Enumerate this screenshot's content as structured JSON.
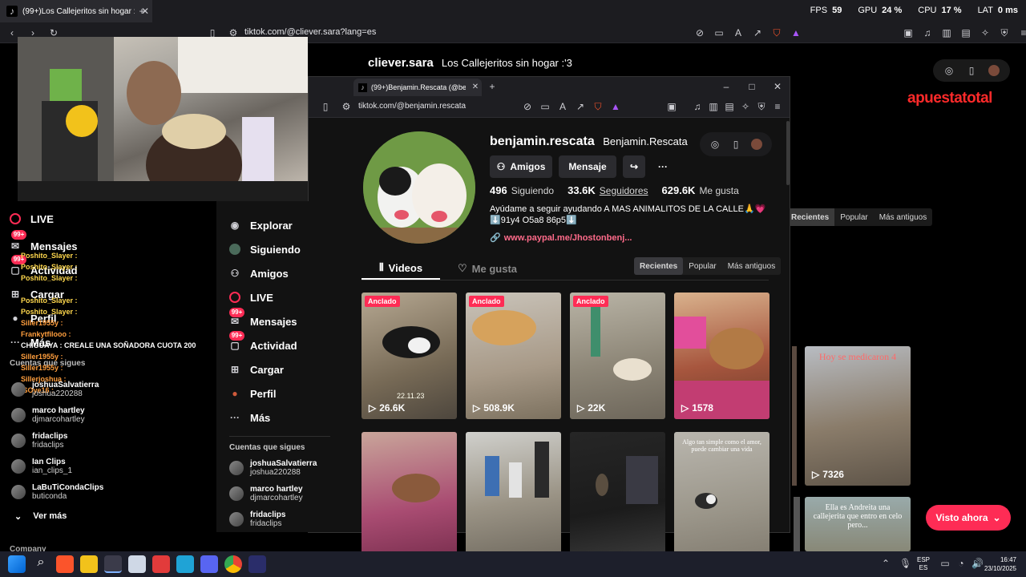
{
  "outer_browser": {
    "tab_title": "(99+)Los Callejeritos sin hogar :'3",
    "url": "tiktok.com/@cliever.sara?lang=es",
    "perf": {
      "fps_label": "FPS",
      "fps": "59",
      "gpu_label": "GPU",
      "gpu": "24 %",
      "cpu_label": "CPU",
      "cpu": "17 %",
      "lat_label": "LAT",
      "lat": "0 ms"
    }
  },
  "outer_page": {
    "username": "cliever.sara",
    "display_name": "Los Callejeritos sin hogar :'3",
    "sponsor": "apuestatotal",
    "filters": [
      "Recientes",
      "Popular",
      "Más antiguos"
    ],
    "views_right": "7326",
    "thumb_right_caption": "Hoy se medicaron 4",
    "thumb_right2_caption": "Ella es Andreita una callejerita que entro en celo pero...",
    "cta": "Visto ahora",
    "nav": {
      "live": "LIVE",
      "messages": "Mensajes",
      "activity": "Actividad",
      "upload": "Cargar",
      "profile": "Perfil",
      "more": "Más",
      "following_title": "Cuentas que sigues",
      "see_more": "Ver más",
      "company": "Company",
      "badge": "99+"
    },
    "following": [
      {
        "name": "joshuaSalvatierra",
        "handle": "joshua220288"
      },
      {
        "name": "marco hartley",
        "handle": "djmarcohartley"
      },
      {
        "name": "fridaclips",
        "handle": "fridaclips"
      },
      {
        "name": "Ian Clips",
        "handle": "ian_clips_1"
      },
      {
        "name": "LaBuTiCondaClips",
        "handle": "buticonda"
      }
    ],
    "chat": [
      {
        "user": "Poshito_Slayer :",
        "color": "#ffd84d"
      },
      {
        "user": "Poshito_Slayer :",
        "color": "#ffd84d"
      },
      {
        "user": "Poshito_Slayer :",
        "color": "#ffd84d"
      },
      {
        "user": "Poshito_Slayer :",
        "color": "#ffd84d"
      },
      {
        "user": "Poshito_Slayer :",
        "color": "#ffd84d"
      },
      {
        "user": "Siller1955y :",
        "color": "#ff9e3d"
      },
      {
        "user": "Frankytfilooo :",
        "color": "#ff9e3d"
      },
      {
        "user": "CHIGUAYA : CREALE UNA SOÑADORA CUOTA 200",
        "color": "#ffffff"
      },
      {
        "user": "Siller1955y :",
        "color": "#ff9e3d"
      },
      {
        "user": "Siller1955y :",
        "color": "#ff9e3d"
      },
      {
        "user": "Sillerjoshua :",
        "color": "#ff9e3d"
      },
      {
        "user": "ISOye16 :",
        "color": "#ff9e3d"
      }
    ]
  },
  "inner_browser": {
    "tab_title": "(99+)Benjamin.Rescata (@benja",
    "url": "tiktok.com/@benjamin.rescata"
  },
  "inner_nav": {
    "explore": "Explorar",
    "following": "Siguiendo",
    "friends": "Amigos",
    "live": "LIVE",
    "messages": "Mensajes",
    "activity": "Actividad",
    "upload": "Cargar",
    "profile": "Perfil",
    "more": "Más",
    "badge": "99+",
    "following_title": "Cuentas que sigues",
    "accounts": [
      {
        "name": "joshuaSalvatierra",
        "handle": "joshua220288"
      },
      {
        "name": "marco hartley",
        "handle": "djmarcohartley"
      },
      {
        "name": "fridaclips",
        "handle": "fridaclips"
      }
    ]
  },
  "profile": {
    "username": "benjamin.rescata",
    "display_name": "Benjamin.Rescata",
    "friends_btn": "Amigos",
    "message_btn": "Mensaje",
    "following_count": "496",
    "following_label": "Siguiendo",
    "followers_count": "33.6K",
    "followers_label": "Seguidores",
    "likes_count": "629.6K",
    "likes_label": "Me gusta",
    "bio_line1": "Ayúdame a seguir ayudando A MAS ANIMALITOS DE LA CALLE🙏💗",
    "bio_line2": "⬇️91y4 O5a8 86p5⬇️",
    "link": "www.paypal.me/Jhostonbenj..."
  },
  "tabs": {
    "videos": "Videos",
    "likes": "Me gusta"
  },
  "filters": [
    "Recientes",
    "Popular",
    "Más antiguos"
  ],
  "videos": [
    {
      "pinned": "Anclado",
      "views": "26.6K",
      "date": "22.11.23"
    },
    {
      "pinned": "Anclado",
      "views": "508.9K"
    },
    {
      "pinned": "Anclado",
      "views": "22K"
    },
    {
      "pinned": "",
      "views": "1578"
    },
    {
      "pinned": "",
      "views": ""
    },
    {
      "pinned": "",
      "views": ""
    },
    {
      "pinned": "",
      "views": ""
    },
    {
      "pinned": "",
      "views": ""
    }
  ],
  "captions": {
    "v5": "Algo tan simple como el amor, puede cambiar una vida"
  },
  "taskbar": {
    "lang1": "ESP",
    "lang2": "ES",
    "time": "16:47",
    "date": "23/10/2025"
  }
}
